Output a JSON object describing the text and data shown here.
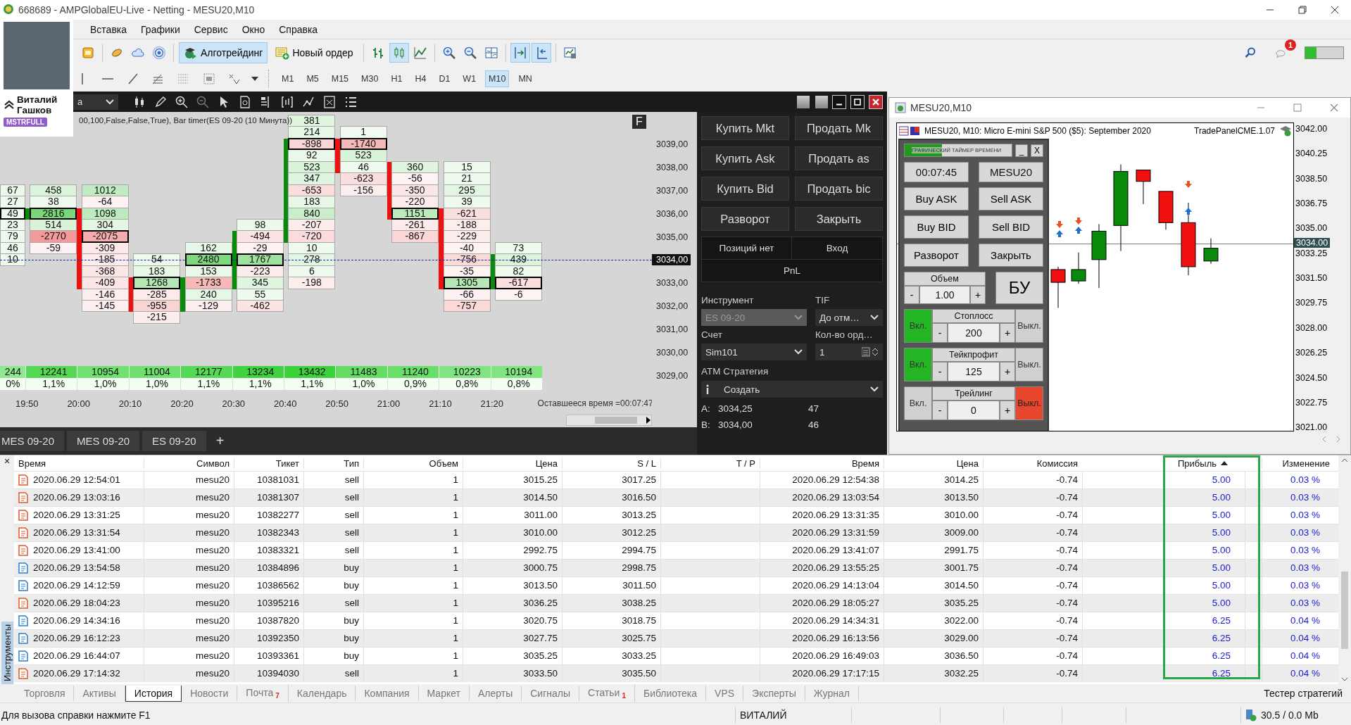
{
  "window": {
    "title": "668689 - AMPGlobalEU-Live - Netting - MESU20,M10"
  },
  "user_card": {
    "name": "Виталий Гашков",
    "badge": "MSTRFULL"
  },
  "menu": [
    "Вставка",
    "Графики",
    "Сервис",
    "Окно",
    "Справка"
  ],
  "toolbar": {
    "chart_types": [
      {
        "selected": false
      },
      {
        "selected": true
      },
      {
        "selected": false
      }
    ],
    "autoscroll": [
      {
        "pressed": true
      },
      {
        "pressed": true
      }
    ],
    "algo": {
      "label": "Алготрейдинг",
      "pressed": true
    },
    "new_order": {
      "label": "Новый ордер"
    },
    "notifications": "1"
  },
  "timeframes": [
    {
      "label": "M1",
      "selected": false
    },
    {
      "label": "M5",
      "selected": false
    },
    {
      "label": "M15",
      "selected": false
    },
    {
      "label": "M30",
      "selected": false
    },
    {
      "label": "H1",
      "selected": false
    },
    {
      "label": "H4",
      "selected": false
    },
    {
      "label": "D1",
      "selected": false
    },
    {
      "label": "W1",
      "selected": false
    },
    {
      "label": "M10",
      "selected": true
    },
    {
      "label": "MN",
      "selected": false
    }
  ],
  "footprint": {
    "instrument": "a",
    "indicator": "00,100,False,False,True), Bar timer(ES 09-20 (10 Минута))",
    "f_button": "F",
    "remaining": "Оставшееся время =00:07:47",
    "columns": [
      {
        "volume": "244",
        "share": "0%",
        "cells": [
          null,
          null,
          null,
          null,
          null,
          null,
          {
            "value": "67",
            "poc": false,
            "body": false
          },
          {
            "value": "27",
            "poc": false,
            "body": false
          },
          {
            "value": "49",
            "poc": true,
            "body": false
          },
          {
            "value": "23",
            "poc": false,
            "body": false
          },
          {
            "value": "79",
            "poc": false,
            "body": false
          },
          {
            "value": "46",
            "poc": false,
            "body": false
          },
          {
            "value": "10",
            "poc": false,
            "body": false
          }
        ]
      },
      {
        "time": "19:50",
        "kind": "up",
        "volume": "12241",
        "share": "1,1%",
        "cells": [
          null,
          null,
          null,
          null,
          null,
          null,
          {
            "value": "458",
            "poc": false,
            "body": false
          },
          {
            "value": "38",
            "poc": false,
            "body": false
          },
          {
            "value": "2816",
            "poc": true,
            "body": true
          },
          {
            "value": "514",
            "poc": false,
            "body": false
          },
          {
            "value": "-2770",
            "poc": false,
            "body": false
          },
          {
            "value": "-59",
            "poc": false,
            "body": false
          }
        ]
      },
      {
        "time": "20:00",
        "kind": "down",
        "volume": "10954",
        "share": "1,0%",
        "cells": [
          null,
          null,
          null,
          null,
          null,
          null,
          {
            "value": "1012",
            "poc": false,
            "body": false
          },
          {
            "value": "-64",
            "poc": false,
            "body": false
          },
          {
            "value": "1098",
            "poc": false,
            "body": true
          },
          {
            "value": "304",
            "poc": false,
            "body": true
          },
          {
            "value": "-2075",
            "poc": true,
            "body": true
          },
          {
            "value": "-309",
            "poc": false,
            "body": true
          },
          {
            "value": "-185",
            "poc": false,
            "body": true
          },
          {
            "value": "-368",
            "poc": false,
            "body": true
          },
          {
            "value": "-409",
            "poc": false,
            "body": true
          },
          {
            "value": "-146",
            "poc": false,
            "body": false
          },
          {
            "value": "-145",
            "poc": false,
            "body": false
          }
        ]
      },
      {
        "time": "20:10",
        "kind": "down",
        "volume": "11004",
        "share": "1,0%",
        "cells": [
          null,
          null,
          null,
          null,
          null,
          null,
          null,
          null,
          null,
          null,
          null,
          null,
          {
            "value": "54",
            "poc": false,
            "body": false
          },
          {
            "value": "183",
            "poc": false,
            "body": false
          },
          {
            "value": "1268",
            "poc": true,
            "body": true
          },
          {
            "value": "-285",
            "poc": false,
            "body": true
          },
          {
            "value": "-955",
            "poc": false,
            "body": true
          },
          {
            "value": "-215",
            "poc": false,
            "body": false
          }
        ]
      },
      {
        "time": "20:20",
        "kind": "up",
        "volume": "12177",
        "share": "1,1%",
        "cells": [
          null,
          null,
          null,
          null,
          null,
          null,
          null,
          null,
          null,
          null,
          null,
          {
            "value": "162",
            "poc": false,
            "body": false
          },
          {
            "value": "2480",
            "poc": true,
            "body": false
          },
          {
            "value": "153",
            "poc": false,
            "body": false
          },
          {
            "value": "-1733",
            "poc": false,
            "body": true
          },
          {
            "value": "240",
            "poc": false,
            "body": true
          },
          {
            "value": "-129",
            "poc": false,
            "body": true
          }
        ]
      },
      {
        "time": "20:30",
        "kind": "up",
        "volume": "13234",
        "share": "1,1%",
        "cells": [
          null,
          null,
          null,
          null,
          null,
          null,
          null,
          null,
          null,
          {
            "value": "98",
            "poc": false,
            "body": false
          },
          {
            "value": "-494",
            "poc": false,
            "body": true
          },
          {
            "value": "-29",
            "poc": false,
            "body": true
          },
          {
            "value": "1767",
            "poc": true,
            "body": true
          },
          {
            "value": "-223",
            "poc": false,
            "body": true
          },
          {
            "value": "345",
            "poc": false,
            "body": true
          },
          {
            "value": "55",
            "poc": false,
            "body": false
          },
          {
            "value": "-462",
            "poc": false,
            "body": false
          }
        ]
      },
      {
        "time": "20:40",
        "kind": "up",
        "volume": "13432",
        "share": "1,1%",
        "cells": [
          {
            "value": "381",
            "poc": false,
            "body": false
          },
          {
            "value": "214",
            "poc": false,
            "body": false
          },
          {
            "value": "-898",
            "poc": true,
            "body": true
          },
          {
            "value": "92",
            "poc": false,
            "body": true
          },
          {
            "value": "523",
            "poc": false,
            "body": true
          },
          {
            "value": "347",
            "poc": false,
            "body": true
          },
          {
            "value": "-653",
            "poc": false,
            "body": true
          },
          {
            "value": "183",
            "poc": false,
            "body": true
          },
          {
            "value": "840",
            "poc": false,
            "body": true
          },
          {
            "value": "-207",
            "poc": false,
            "body": true
          },
          {
            "value": "-720",
            "poc": false,
            "body": true
          },
          {
            "value": "10",
            "poc": false,
            "body": false
          },
          {
            "value": "278",
            "poc": false,
            "body": false
          },
          {
            "value": "6",
            "poc": false,
            "body": false
          },
          {
            "value": "-198",
            "poc": false,
            "body": false
          }
        ]
      },
      {
        "time": "20:50",
        "kind": "down",
        "volume": "11483",
        "share": "1,0%",
        "cells": [
          null,
          {
            "value": "1",
            "poc": false,
            "body": false
          },
          {
            "value": "-1740",
            "poc": true,
            "body": true
          },
          {
            "value": "523",
            "poc": false,
            "body": true
          },
          {
            "value": "46",
            "poc": false,
            "body": true
          },
          {
            "value": "-623",
            "poc": false,
            "body": false
          },
          {
            "value": "-156",
            "poc": false,
            "body": false
          }
        ]
      },
      {
        "time": "21:00",
        "kind": "down",
        "volume": "11240",
        "share": "0,9%",
        "cells": [
          null,
          null,
          null,
          null,
          {
            "value": "360",
            "poc": false,
            "body": true
          },
          {
            "value": "-56",
            "poc": false,
            "body": true
          },
          {
            "value": "-350",
            "poc": false,
            "body": true
          },
          {
            "value": "-220",
            "poc": false,
            "body": true
          },
          {
            "value": "1151",
            "poc": true,
            "body": true
          },
          {
            "value": "-261",
            "poc": false,
            "body": false
          },
          {
            "value": "-867",
            "poc": false,
            "body": false
          }
        ]
      },
      {
        "time": "21:10",
        "kind": "down",
        "volume": "10223",
        "share": "0,8%",
        "cells": [
          null,
          null,
          null,
          null,
          {
            "value": "15",
            "poc": false,
            "body": false
          },
          {
            "value": "21",
            "poc": false,
            "body": false
          },
          {
            "value": "295",
            "poc": false,
            "body": false
          },
          {
            "value": "39",
            "poc": false,
            "body": false
          },
          {
            "value": "-621",
            "poc": false,
            "body": true
          },
          {
            "value": "-188",
            "poc": false,
            "body": true
          },
          {
            "value": "-229",
            "poc": false,
            "body": true
          },
          {
            "value": "-40",
            "poc": false,
            "body": true
          },
          {
            "value": "-756",
            "poc": false,
            "body": true
          },
          {
            "value": "-35",
            "poc": false,
            "body": true
          },
          {
            "value": "1305",
            "poc": true,
            "body": true
          },
          {
            "value": "-66",
            "poc": false,
            "body": false
          },
          {
            "value": "-757",
            "poc": false,
            "body": false
          }
        ]
      },
      {
        "time": "21:20",
        "kind": "up",
        "volume": "10194",
        "share": "0,8%",
        "cells": [
          null,
          null,
          null,
          null,
          null,
          null,
          null,
          null,
          null,
          null,
          null,
          {
            "value": "73",
            "poc": false,
            "body": false
          },
          {
            "value": "439",
            "poc": false,
            "body": true
          },
          {
            "value": "82",
            "poc": false,
            "body": true
          },
          {
            "value": "-617",
            "poc": true,
            "body": true
          },
          {
            "value": "-6",
            "poc": false,
            "body": false
          }
        ]
      }
    ],
    "price_labels": [
      {
        "text": "3039,00",
        "current": false
      },
      {
        "text": "3038,00",
        "current": false
      },
      {
        "text": "3037,00",
        "current": false
      },
      {
        "text": "3036,00",
        "current": false
      },
      {
        "text": "3035,00",
        "current": false
      },
      {
        "text": "3034,00",
        "current": true
      },
      {
        "text": "3033,00",
        "current": false
      },
      {
        "text": "3032,00",
        "current": false
      },
      {
        "text": "3031,00",
        "current": false
      },
      {
        "text": "3030,00",
        "current": false
      },
      {
        "text": "3029,00",
        "current": false
      }
    ],
    "tabs": [
      "MES 09-20",
      "MES 09-20",
      "ES 09-20"
    ],
    "add_tab": "+"
  },
  "order_panel": {
    "buttons": [
      "Купить Mkt",
      "Продать Mk",
      "Купить Ask",
      "Продать as",
      "Купить Bid",
      "Продать bic",
      "Разворот",
      "Закрыть"
    ],
    "position": "Позиций нет",
    "entry": "Вход",
    "pnl": "PnL",
    "instrument_label": "Инструмент",
    "tif_label": "TIF",
    "instrument": {
      "value": "ES 09-20",
      "disabled": true
    },
    "tif": "До отм…",
    "account_label": "Счет",
    "orders_label": "Кол-во орд…",
    "account": "Sim101",
    "orders": "1",
    "atm_label": "ATM Стратегия",
    "atm": "Создать",
    "quotes": [
      {
        "label": "A:",
        "price": "3034,25",
        "size": "47"
      },
      {
        "label": "B:",
        "price": "3034,00",
        "size": "46"
      }
    ]
  },
  "chart_window": {
    "title": "MESU20,M10",
    "header": "MESU20, M10:  Micro E-mini S&P 500 ($5): September 2020",
    "expert": "TradePanelCME.1.07",
    "price_labels": [
      {
        "text": "3042.00",
        "current": false
      },
      {
        "text": "3040.25",
        "current": false
      },
      {
        "text": "3038.50",
        "current": false
      },
      {
        "text": "3036.75",
        "current": false
      },
      {
        "text": "3035.00",
        "current": false
      },
      {
        "text": "3034.00",
        "current": true
      },
      {
        "text": "3033.25",
        "current": false
      },
      {
        "text": "3031.50",
        "current": false
      },
      {
        "text": "3029.75",
        "current": false
      },
      {
        "text": "3028.00",
        "current": false
      },
      {
        "text": "3026.25",
        "current": false
      },
      {
        "text": "3024.50",
        "current": false
      },
      {
        "text": "3022.75",
        "current": false
      },
      {
        "text": "3021.00",
        "current": false
      }
    ]
  },
  "trade_panel": {
    "timer_bar": {
      "label": "ГРАФИЧЕСКИЙ ТАЙМЕР ВРЕМЕНИ",
      "level": 0.35
    },
    "minimize": "_",
    "close": "X",
    "timer": "00:07:45",
    "symbol": "MESU20",
    "buttons": [
      "Buy ASK",
      "Sell ASK",
      "Buy BID",
      "Sell BID",
      "Разворот",
      "Закрыть"
    ],
    "volume": {
      "label": "Объем",
      "minus": "-",
      "value": "1.00",
      "plus": "+"
    },
    "breakeven": "БУ",
    "toggles": [
      {
        "on_label": "Вкл.",
        "label": "Стоплосс",
        "minus": "-",
        "value": "200",
        "plus": "+",
        "off_label": "Выкл.",
        "on": true
      },
      {
        "on_label": "Вкл.",
        "label": "Тейкпрофит",
        "minus": "-",
        "value": "125",
        "plus": "+",
        "off_label": "Выкл.",
        "on": true
      },
      {
        "on_label": "Вкл.",
        "label": "Трейлинг",
        "minus": "-",
        "value": "0",
        "plus": "+",
        "off_label": "Выкл.",
        "on": false
      }
    ]
  },
  "side_tab": {
    "label": "Инструменты",
    "close": "×"
  },
  "history": {
    "columns": [
      {
        "label": "Время",
        "sorted": false
      },
      {
        "label": "Символ",
        "sorted": false
      },
      {
        "label": "Тикет",
        "sorted": false
      },
      {
        "label": "Тип",
        "sorted": false
      },
      {
        "label": "Объем",
        "sorted": false
      },
      {
        "label": "Цена",
        "sorted": false
      },
      {
        "label": "S / L",
        "sorted": false
      },
      {
        "label": "T / P",
        "sorted": false
      },
      {
        "label": "Время",
        "sorted": false
      },
      {
        "label": "Цена",
        "sorted": false
      },
      {
        "label": "Комиссия",
        "sorted": false
      },
      {
        "label": "Прибыль",
        "sorted": true
      },
      {
        "label": "Изменение",
        "sorted": false
      }
    ],
    "rows": [
      {
        "kind": "sell",
        "cells": [
          "2020.06.29 12:54:01",
          "mesu20",
          "10381031",
          "sell",
          "1",
          "3015.25",
          "3017.25",
          "",
          "2020.06.29 12:54:38",
          "3014.25",
          "-0.74",
          "5.00",
          "0.03 %"
        ]
      },
      {
        "kind": "sell",
        "cells": [
          "2020.06.29 13:03:16",
          "mesu20",
          "10381307",
          "sell",
          "1",
          "3014.50",
          "3016.50",
          "",
          "2020.06.29 13:03:54",
          "3013.50",
          "-0.74",
          "5.00",
          "0.03 %"
        ]
      },
      {
        "kind": "sell",
        "cells": [
          "2020.06.29 13:31:25",
          "mesu20",
          "10382277",
          "sell",
          "1",
          "3011.00",
          "3013.25",
          "",
          "2020.06.29 13:31:35",
          "3010.00",
          "-0.74",
          "5.00",
          "0.03 %"
        ]
      },
      {
        "kind": "sell",
        "cells": [
          "2020.06.29 13:31:54",
          "mesu20",
          "10382343",
          "sell",
          "1",
          "3010.00",
          "3012.25",
          "",
          "2020.06.29 13:31:59",
          "3009.00",
          "-0.74",
          "5.00",
          "0.03 %"
        ]
      },
      {
        "kind": "sell",
        "cells": [
          "2020.06.29 13:41:00",
          "mesu20",
          "10383321",
          "sell",
          "1",
          "2992.75",
          "2994.75",
          "",
          "2020.06.29 13:41:07",
          "2991.75",
          "-0.74",
          "5.00",
          "0.03 %"
        ]
      },
      {
        "kind": "buy",
        "cells": [
          "2020.06.29 13:54:58",
          "mesu20",
          "10384896",
          "buy",
          "1",
          "3000.75",
          "2998.75",
          "",
          "2020.06.29 13:55:25",
          "3001.75",
          "-0.74",
          "5.00",
          "0.03 %"
        ]
      },
      {
        "kind": "buy",
        "cells": [
          "2020.06.29 14:12:59",
          "mesu20",
          "10386562",
          "buy",
          "1",
          "3013.50",
          "3011.50",
          "",
          "2020.06.29 14:13:04",
          "3014.50",
          "-0.74",
          "5.00",
          "0.03 %"
        ]
      },
      {
        "kind": "sell",
        "cells": [
          "2020.06.29 18:04:23",
          "mesu20",
          "10395216",
          "sell",
          "1",
          "3036.25",
          "3038.25",
          "",
          "2020.06.29 18:05:27",
          "3035.25",
          "-0.74",
          "5.00",
          "0.03 %"
        ]
      },
      {
        "kind": "buy",
        "cells": [
          "2020.06.29 14:34:16",
          "mesu20",
          "10387820",
          "buy",
          "1",
          "3020.75",
          "3018.75",
          "",
          "2020.06.29 14:34:31",
          "3022.00",
          "-0.74",
          "6.25",
          "0.04 %"
        ]
      },
      {
        "kind": "buy",
        "cells": [
          "2020.06.29 16:12:23",
          "mesu20",
          "10392350",
          "buy",
          "1",
          "3027.75",
          "3025.75",
          "",
          "2020.06.29 16:13:56",
          "3029.00",
          "-0.74",
          "6.25",
          "0.04 %"
        ]
      },
      {
        "kind": "buy",
        "cells": [
          "2020.06.29 16:44:07",
          "mesu20",
          "10393361",
          "buy",
          "1",
          "3035.25",
          "3033.25",
          "",
          "2020.06.29 16:49:03",
          "3036.50",
          "-0.74",
          "6.25",
          "0.04 %"
        ]
      },
      {
        "kind": "sell",
        "cells": [
          "2020.06.29 17:14:32",
          "mesu20",
          "10394030",
          "sell",
          "1",
          "3033.50",
          "3035.50",
          "",
          "2020.06.29 17:17:15",
          "3032.25",
          "-0.74",
          "6.25",
          "0.04 %"
        ]
      }
    ]
  },
  "bottom_tabs": [
    {
      "label": "Торговля",
      "selected": false
    },
    {
      "label": "Активы",
      "selected": false
    },
    {
      "label": "История",
      "selected": true
    },
    {
      "label": "Новости",
      "selected": false
    },
    {
      "label": "Почта",
      "badge": "7",
      "selected": false
    },
    {
      "label": "Календарь",
      "selected": false
    },
    {
      "label": "Компания",
      "selected": false
    },
    {
      "label": "Маркет",
      "selected": false
    },
    {
      "label": "Алерты",
      "selected": false
    },
    {
      "label": "Сигналы",
      "selected": false
    },
    {
      "label": "Статьи",
      "badge": "1",
      "selected": false
    },
    {
      "label": "Библиотека",
      "selected": false
    },
    {
      "label": "VPS",
      "selected": false
    },
    {
      "label": "Эксперты",
      "selected": false
    },
    {
      "label": "Журнал",
      "selected": false
    }
  ],
  "strategy_tester": "Тестер стратегий",
  "status_bar": {
    "help": "Для вызова справки нажмите F1",
    "profile": "ВИТАЛИЙ",
    "traffic": "30.5 / 0.0 Mb"
  }
}
